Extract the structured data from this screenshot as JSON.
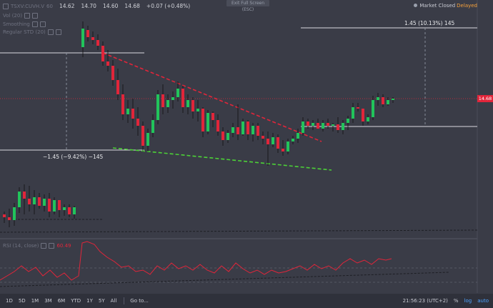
{
  "symbol": {
    "name": "TSXV:CUVH.V",
    "interval": "60",
    "open": "14.62",
    "high": "14.70",
    "low": "14.60",
    "close": "14.68",
    "change": "+0.07 (+0.48%)"
  },
  "legend_rows": [
    "Vol (20)",
    "Smoothing",
    "Regular STD (20)"
  ],
  "exit_fullscreen_label": "Exit Full Screen (ESC)",
  "market_status": {
    "label": "Market Closed",
    "delay": "Delayed"
  },
  "price_tag": "14.68",
  "measure_up": "1.45 (10.13%) 145",
  "measure_down": "−1.45 (−9.42%) −145",
  "indicator_label": "RSI (14, close)",
  "indicator_value": "60.49",
  "toolbar": {
    "timeframes": [
      "1D",
      "5D",
      "1M",
      "3M",
      "6M",
      "YTD",
      "1Y",
      "5Y",
      "All"
    ],
    "goto": "Go to...",
    "time": "21:56:23 (UTC+2)",
    "percent": "%",
    "log": "log",
    "auto": "auto"
  },
  "colors": {
    "background": "#3a3c47",
    "up": "#21c45b",
    "down": "#e1253a",
    "trend_down": "#e1253a",
    "trend_support": "#4cd137",
    "indicator": "#e1253a"
  }
}
